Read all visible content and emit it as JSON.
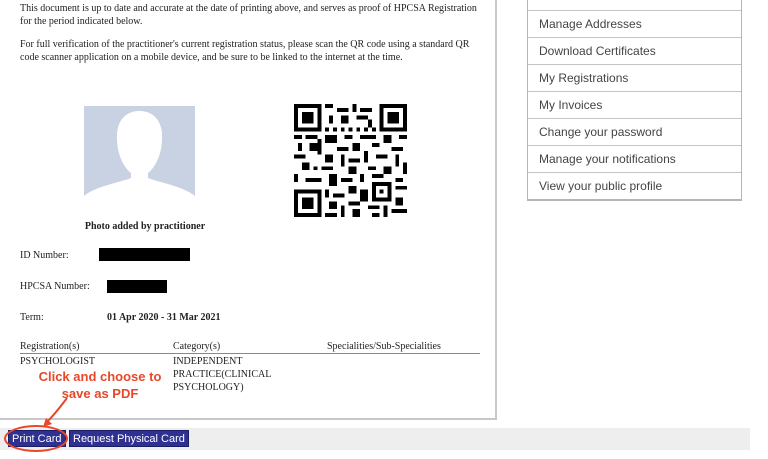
{
  "document": {
    "paragraph1": "This document is up to date and accurate at the date of printing above, and serves as proof of HPCSA Registration for the period indicated below.",
    "paragraph2": "For full verification of the practitioner's current registration status, please scan the QR code using a standard QR code scanner application on a mobile device, and be sure to be linked to the internet at the time.",
    "photo_caption": "Photo added by practitioner",
    "id_label": "ID Number:",
    "hpcsa_label": "HPCSA Number:",
    "term_label": "Term:",
    "term_value": "01 Apr 2020 - 31 Mar 2021",
    "table": {
      "headers": [
        "Registration(s)",
        "Category(s)",
        "Specialities/Sub-Specialities"
      ],
      "row": [
        "PSYCHOLOGIST",
        "INDEPENDENT PRACTICE(CLINICAL PSYCHOLOGY)",
        ""
      ]
    }
  },
  "annotation": {
    "text": "Click and choose to save as PDF",
    "color": "#e8472a"
  },
  "buttons": {
    "print_card": "Print Card",
    "request_physical": "Request Physical Card",
    "color": "#2e3192"
  },
  "menu": {
    "items": [
      "Manage Addresses",
      "Download Certificates",
      "My Registrations",
      "My Invoices",
      "Change your password",
      "Manage your notifications",
      "View your public profile"
    ]
  }
}
